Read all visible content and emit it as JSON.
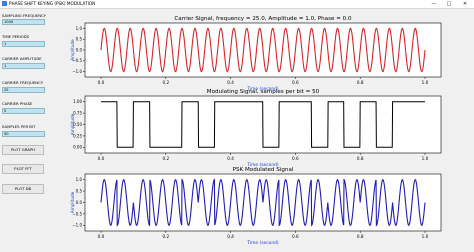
{
  "window": {
    "title": "PHASE SHIFT KEYING (PSK) MODULATION",
    "minimize": "—",
    "maximize": "□",
    "close": "✕"
  },
  "controls": {
    "sampling_frequency": {
      "label": "SAMPLING FREQUENCY",
      "value": "1000"
    },
    "time_periods": {
      "label": "TIME PERIODS",
      "value": "1"
    },
    "carrier_amplitude": {
      "label": "CARRIER AMPLITUDE",
      "value": "1"
    },
    "carrier_frequency": {
      "label": "CARRIER FREQUENCY",
      "value": "25"
    },
    "carrier_phase": {
      "label": "CARRIER PHASE",
      "value": "0"
    },
    "samples_per_bit": {
      "label": "SAMPLES PER BIT",
      "value": "50"
    },
    "buttons": {
      "plot_graph": "PLOT GRAPH",
      "plot_fft": "PLOT FFT",
      "plot_db": "PLOT DB"
    }
  },
  "chart_data": [
    {
      "type": "line",
      "title": "Carrier Signal, frequency = 25.0, Amplitude = 1.0, Phase = 0.0",
      "xlabel": "Time (second)",
      "ylabel": "Amplitude",
      "xlim": [
        0,
        1
      ],
      "ylim": [
        -1,
        1
      ],
      "xticks": [
        "0.0",
        "0.2",
        "0.4",
        "0.6",
        "0.8",
        "1.0"
      ],
      "yticks": [
        "1.0",
        "0.5",
        "0.0",
        "−0.5",
        "−1.0"
      ],
      "series": [
        {
          "frequency": 25,
          "amplitude": 1,
          "phase": 0,
          "color": "#d62728"
        }
      ]
    },
    {
      "type": "line",
      "title": "Modulating Signal, samples per bit = 50",
      "xlabel": "Time (second)",
      "ylabel": "Amplitude",
      "xlim": [
        0,
        1
      ],
      "ylim": [
        0,
        1
      ],
      "xticks": [
        "0.0",
        "0.2",
        "0.4",
        "0.6",
        "0.8",
        "1.0"
      ],
      "yticks": [
        "1.00",
        "0.75",
        "0.50",
        "0.25",
        "0.00"
      ],
      "series": [
        {
          "bits": [
            1,
            0,
            1,
            0,
            0,
            1,
            0,
            1,
            1,
            1,
            0,
            1,
            1,
            0,
            1,
            0,
            1,
            0,
            1,
            1
          ],
          "bit_duration": 0.05,
          "color": "#000000"
        }
      ]
    },
    {
      "type": "line",
      "title": "PSK Modulated Signal",
      "xlabel": "Time (second)",
      "ylabel": "Amplitude",
      "xlim": [
        0,
        1
      ],
      "ylim": [
        -1,
        1
      ],
      "xticks": [
        "0.0",
        "0.2",
        "0.4",
        "0.6",
        "0.8",
        "1.0"
      ],
      "yticks": [
        "1.0",
        "0.5",
        "0.0",
        "−0.5",
        "−1.0"
      ],
      "series": [
        {
          "frequency": 25,
          "amplitude": 1,
          "bits": [
            1,
            0,
            1,
            0,
            0,
            1,
            0,
            1,
            1,
            1,
            0,
            1,
            1,
            0,
            1,
            0,
            1,
            0,
            1,
            1
          ],
          "bit_duration": 0.05,
          "color": "#1f1fb4"
        }
      ]
    }
  ]
}
